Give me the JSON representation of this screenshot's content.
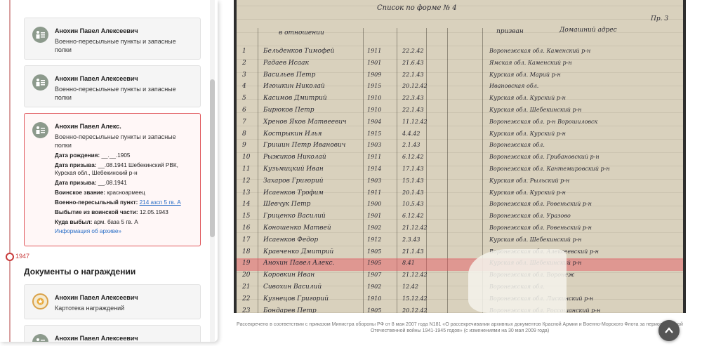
{
  "timeline": {
    "year": "1947"
  },
  "cards": [
    {
      "name": "Анохин Павел Алексеевич",
      "subtitle": "Военно-пересыльные пункты и запасные полки"
    },
    {
      "name": "Анохин Павел Алексеевич",
      "subtitle": "Военно-пересыльные пункты и запасные полки"
    }
  ],
  "active_card": {
    "name": "Анохин Павел Алекс.",
    "subtitle": "Военно-пересыльные пункты и запасные полки",
    "fields": [
      {
        "label": "Дата рождения:",
        "value": "__.__.1905"
      },
      {
        "label": "Дата призыва:",
        "value": "__.08.1941 Шебекинский РВК, Курская обл., Шебекинский р-н"
      },
      {
        "label": "Дата призыва:",
        "value": "__.08.1941"
      },
      {
        "label": "Воинское звание:",
        "value": "красноармеец"
      }
    ],
    "transit_label": "Военно-пересыльный пункт:",
    "transit_link": "214 азсп 5 гв. А",
    "left_label": "Выбытие из воинской части:",
    "left_value": "12.05.1943",
    "where_label": "Куда выбыл:",
    "where_value": "арм. база 5 гв. А",
    "archive_link": "Информация об архиве»"
  },
  "awards_section": {
    "title": "Документы о награждении",
    "cards": [
      {
        "name": "Анохин Павел Алексеевич",
        "subtitle": "Картотека награждений"
      },
      {
        "name": "Анохин Павел Алексеевич"
      }
    ]
  },
  "document": {
    "header_title": "Список по форме № 4",
    "header_right": "Пр. 3",
    "column_header_left": "в отношении",
    "column_header_mid": "призван",
    "column_header_right": "Домашний адрес",
    "rows": [
      {
        "num": "1",
        "name": "Бельденков Тимофей",
        "year": "1911",
        "date": "22.2.42",
        "addr": "Воронежская обл. Каменский р-н"
      },
      {
        "num": "2",
        "name": "Радаев Исаак",
        "year": "1901",
        "date": "21.6.43",
        "addr": "Ямская обл. Каменский р-н"
      },
      {
        "num": "3",
        "name": "Васильев Петр",
        "year": "1909",
        "date": "22.1.43",
        "addr": "Курская обл. Марий р-н"
      },
      {
        "num": "4",
        "name": "Игошкин Николай",
        "year": "1915",
        "date": "20.12.42",
        "addr": "Ивановская обл."
      },
      {
        "num": "5",
        "name": "Касимов Дмитрий",
        "year": "1910",
        "date": "22.3.43",
        "addr": "Курская обл. Курский р-н"
      },
      {
        "num": "6",
        "name": "Бирюков Петр",
        "year": "1910",
        "date": "22.1.43",
        "addr": "Курская обл. Шебекинский р-н"
      },
      {
        "num": "7",
        "name": "Хренов Яков Матвеевич",
        "year": "1904",
        "date": "11.12.42",
        "addr": "Воронежская обл. р-н Ворошиловск"
      },
      {
        "num": "8",
        "name": "Кострыкин Илья",
        "year": "1915",
        "date": "4.4.42",
        "addr": "Курская обл. Курский р-н"
      },
      {
        "num": "9",
        "name": "Гришин Петр Иванович",
        "year": "1903",
        "date": "2.1.43",
        "addr": "Воронежская обл."
      },
      {
        "num": "10",
        "name": "Рыжиков Николай",
        "year": "1911",
        "date": "6.12.42",
        "addr": "Воронежская обл. Грибановский р-н"
      },
      {
        "num": "11",
        "name": "Кузьмицкий Иван",
        "year": "1914",
        "date": "17.1.43",
        "addr": "Воронежская обл. Кантемировский р-н"
      },
      {
        "num": "12",
        "name": "Захаров Григорий",
        "year": "1903",
        "date": "15.1.43",
        "addr": "Курская обл. Рыльский р-н"
      },
      {
        "num": "13",
        "name": "Исаенков Трофим",
        "year": "1911",
        "date": "20.1.43",
        "addr": "Курская обл. Курский р-н"
      },
      {
        "num": "14",
        "name": "Шевчук Петр",
        "year": "1900",
        "date": "10.5.43",
        "addr": "Воронежская обл. Ровеньский р-н"
      },
      {
        "num": "15",
        "name": "Гриценко Василий",
        "year": "1901",
        "date": "6.12.42",
        "addr": "Воронежская обл. Уразово"
      },
      {
        "num": "16",
        "name": "Коношенко Матвей",
        "year": "1902",
        "date": "21.12.42",
        "addr": "Воронежская обл. Ровеньский р-н"
      },
      {
        "num": "17",
        "name": "Исаенков Федор",
        "year": "1912",
        "date": "2.3.43",
        "addr": "Курская обл. Шебекинский р-н"
      },
      {
        "num": "18",
        "name": "Кравченко Дмитрий",
        "year": "1905",
        "date": "21.1.43",
        "addr": "Воронежская обл. Алексеевский р-н"
      },
      {
        "num": "19",
        "name": "Анохин Павел Алекс.",
        "year": "1905",
        "date": "8.41",
        "addr": "Курская обл. Шебекинский р-н"
      },
      {
        "num": "20",
        "name": "Коровкин Иван",
        "year": "1907",
        "date": "21.12.42",
        "addr": "Воронежская обл. Воронеж"
      },
      {
        "num": "21",
        "name": "Сивохин Василий",
        "year": "1902",
        "date": "12.42",
        "addr": "Воронежская обл."
      },
      {
        "num": "22",
        "name": "Кузнецов Григорий",
        "year": "1910",
        "date": "15.12.42",
        "addr": "Воронежская обл. Лискинский р-н"
      },
      {
        "num": "23",
        "name": "Бондарев Петр",
        "year": "1905",
        "date": "20.12.42",
        "addr": "Воронежская обл. Россошанский р-н"
      }
    ]
  },
  "caption": "Рассекречено в соответствии с приказом Министра обороны РФ от 8 мая 2007 года N181 «О рассекречивании архивных документов Красной Армии и Военно-Морского Флота за период Великой Отечественной войны 1941-1945 годов» (с изменениями на 30 мая 2009 года)"
}
